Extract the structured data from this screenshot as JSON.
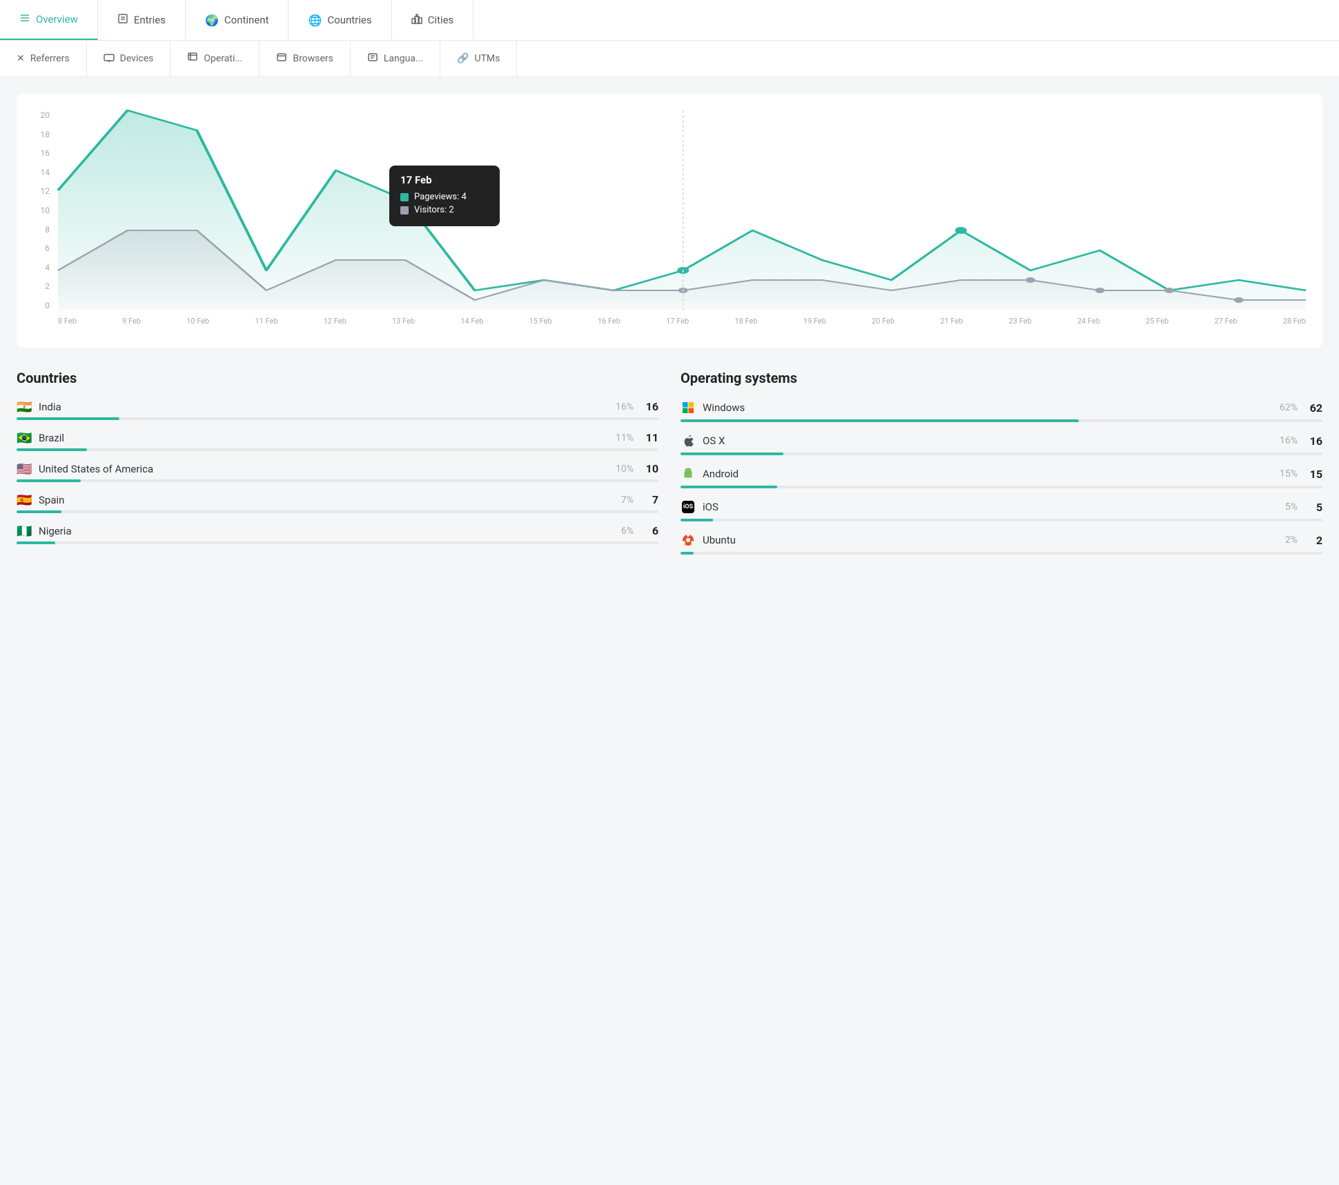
{
  "nav": {
    "primary": [
      {
        "id": "overview",
        "label": "Overview",
        "icon": "☰",
        "active": true
      },
      {
        "id": "entries",
        "label": "Entries",
        "icon": "📋"
      },
      {
        "id": "continent",
        "label": "Continent",
        "icon": "🌍"
      },
      {
        "id": "countries",
        "label": "Countries",
        "icon": "🌐"
      },
      {
        "id": "cities",
        "label": "Cities",
        "icon": "🏙"
      }
    ],
    "secondary": [
      {
        "id": "referrers",
        "label": "Referrers",
        "icon": "↗"
      },
      {
        "id": "devices",
        "label": "Devices",
        "icon": "🖥"
      },
      {
        "id": "operating",
        "label": "Operati...",
        "icon": "⬛"
      },
      {
        "id": "browsers",
        "label": "Browsers",
        "icon": "⬜"
      },
      {
        "id": "languages",
        "label": "Langua...",
        "icon": "🔡"
      },
      {
        "id": "utms",
        "label": "UTMs",
        "icon": "🔗"
      }
    ]
  },
  "chart": {
    "yLabels": [
      "0",
      "2",
      "4",
      "6",
      "8",
      "10",
      "12",
      "14",
      "16",
      "18",
      "20"
    ],
    "xLabels": [
      "8 Feb",
      "9 Feb",
      "10 Feb",
      "11 Feb",
      "12 Feb",
      "13 Feb",
      "14 Feb",
      "15 Feb",
      "16 Feb",
      "17 Feb",
      "18 Feb",
      "19 Feb",
      "20 Feb",
      "21 Feb",
      "23 Feb",
      "24 Feb",
      "25 Feb",
      "27 Feb",
      "28 Feb"
    ]
  },
  "tooltip": {
    "date": "17 Feb",
    "rows": [
      {
        "label": "Pageviews: 4",
        "color": "#2eb8a0"
      },
      {
        "label": "Visitors: 2",
        "color": "#aaa"
      }
    ]
  },
  "countries": {
    "title": "Countries",
    "items": [
      {
        "flag": "🇮🇳",
        "name": "India",
        "pct": "16%",
        "count": "16",
        "bar": 16
      },
      {
        "flag": "🇧🇷",
        "name": "Brazil",
        "pct": "11%",
        "count": "11",
        "bar": 11
      },
      {
        "flag": "🇺🇸",
        "name": "United States of America",
        "pct": "10%",
        "count": "10",
        "bar": 10
      },
      {
        "flag": "🇪🇸",
        "name": "Spain",
        "pct": "7%",
        "count": "7",
        "bar": 7
      },
      {
        "flag": "🇳🇬",
        "name": "Nigeria",
        "pct": "6%",
        "count": "6",
        "bar": 6
      }
    ]
  },
  "os": {
    "title": "Operating systems",
    "items": [
      {
        "icon": "windows",
        "name": "Windows",
        "pct": "62%",
        "count": "62",
        "bar": 62
      },
      {
        "icon": "apple",
        "name": "OS X",
        "pct": "16%",
        "count": "16",
        "bar": 16
      },
      {
        "icon": "android",
        "name": "Android",
        "pct": "15%",
        "count": "15",
        "bar": 15
      },
      {
        "icon": "ios",
        "name": "iOS",
        "pct": "5%",
        "count": "5",
        "bar": 5
      },
      {
        "icon": "ubuntu",
        "name": "Ubuntu",
        "pct": "2%",
        "count": "2",
        "bar": 2
      }
    ]
  },
  "colors": {
    "accent": "#2eb8a0",
    "accentLight": "rgba(46,184,160,0.15)",
    "gray": "#9ca3af"
  }
}
